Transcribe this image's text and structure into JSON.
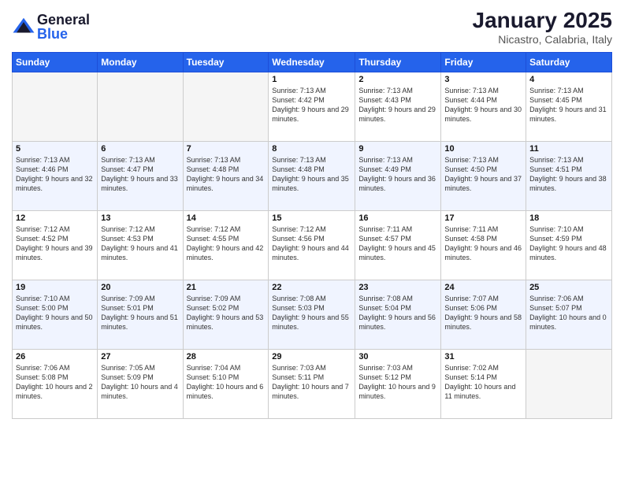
{
  "logo": {
    "general": "General",
    "blue": "Blue"
  },
  "title": "January 2025",
  "location": "Nicastro, Calabria, Italy",
  "days_of_week": [
    "Sunday",
    "Monday",
    "Tuesday",
    "Wednesday",
    "Thursday",
    "Friday",
    "Saturday"
  ],
  "weeks": [
    [
      {
        "num": "",
        "sunrise": "",
        "sunset": "",
        "daylight": ""
      },
      {
        "num": "",
        "sunrise": "",
        "sunset": "",
        "daylight": ""
      },
      {
        "num": "",
        "sunrise": "",
        "sunset": "",
        "daylight": ""
      },
      {
        "num": "1",
        "sunrise": "Sunrise: 7:13 AM",
        "sunset": "Sunset: 4:42 PM",
        "daylight": "Daylight: 9 hours and 29 minutes."
      },
      {
        "num": "2",
        "sunrise": "Sunrise: 7:13 AM",
        "sunset": "Sunset: 4:43 PM",
        "daylight": "Daylight: 9 hours and 29 minutes."
      },
      {
        "num": "3",
        "sunrise": "Sunrise: 7:13 AM",
        "sunset": "Sunset: 4:44 PM",
        "daylight": "Daylight: 9 hours and 30 minutes."
      },
      {
        "num": "4",
        "sunrise": "Sunrise: 7:13 AM",
        "sunset": "Sunset: 4:45 PM",
        "daylight": "Daylight: 9 hours and 31 minutes."
      }
    ],
    [
      {
        "num": "5",
        "sunrise": "Sunrise: 7:13 AM",
        "sunset": "Sunset: 4:46 PM",
        "daylight": "Daylight: 9 hours and 32 minutes."
      },
      {
        "num": "6",
        "sunrise": "Sunrise: 7:13 AM",
        "sunset": "Sunset: 4:47 PM",
        "daylight": "Daylight: 9 hours and 33 minutes."
      },
      {
        "num": "7",
        "sunrise": "Sunrise: 7:13 AM",
        "sunset": "Sunset: 4:48 PM",
        "daylight": "Daylight: 9 hours and 34 minutes."
      },
      {
        "num": "8",
        "sunrise": "Sunrise: 7:13 AM",
        "sunset": "Sunset: 4:48 PM",
        "daylight": "Daylight: 9 hours and 35 minutes."
      },
      {
        "num": "9",
        "sunrise": "Sunrise: 7:13 AM",
        "sunset": "Sunset: 4:49 PM",
        "daylight": "Daylight: 9 hours and 36 minutes."
      },
      {
        "num": "10",
        "sunrise": "Sunrise: 7:13 AM",
        "sunset": "Sunset: 4:50 PM",
        "daylight": "Daylight: 9 hours and 37 minutes."
      },
      {
        "num": "11",
        "sunrise": "Sunrise: 7:13 AM",
        "sunset": "Sunset: 4:51 PM",
        "daylight": "Daylight: 9 hours and 38 minutes."
      }
    ],
    [
      {
        "num": "12",
        "sunrise": "Sunrise: 7:12 AM",
        "sunset": "Sunset: 4:52 PM",
        "daylight": "Daylight: 9 hours and 39 minutes."
      },
      {
        "num": "13",
        "sunrise": "Sunrise: 7:12 AM",
        "sunset": "Sunset: 4:53 PM",
        "daylight": "Daylight: 9 hours and 41 minutes."
      },
      {
        "num": "14",
        "sunrise": "Sunrise: 7:12 AM",
        "sunset": "Sunset: 4:55 PM",
        "daylight": "Daylight: 9 hours and 42 minutes."
      },
      {
        "num": "15",
        "sunrise": "Sunrise: 7:12 AM",
        "sunset": "Sunset: 4:56 PM",
        "daylight": "Daylight: 9 hours and 44 minutes."
      },
      {
        "num": "16",
        "sunrise": "Sunrise: 7:11 AM",
        "sunset": "Sunset: 4:57 PM",
        "daylight": "Daylight: 9 hours and 45 minutes."
      },
      {
        "num": "17",
        "sunrise": "Sunrise: 7:11 AM",
        "sunset": "Sunset: 4:58 PM",
        "daylight": "Daylight: 9 hours and 46 minutes."
      },
      {
        "num": "18",
        "sunrise": "Sunrise: 7:10 AM",
        "sunset": "Sunset: 4:59 PM",
        "daylight": "Daylight: 9 hours and 48 minutes."
      }
    ],
    [
      {
        "num": "19",
        "sunrise": "Sunrise: 7:10 AM",
        "sunset": "Sunset: 5:00 PM",
        "daylight": "Daylight: 9 hours and 50 minutes."
      },
      {
        "num": "20",
        "sunrise": "Sunrise: 7:09 AM",
        "sunset": "Sunset: 5:01 PM",
        "daylight": "Daylight: 9 hours and 51 minutes."
      },
      {
        "num": "21",
        "sunrise": "Sunrise: 7:09 AM",
        "sunset": "Sunset: 5:02 PM",
        "daylight": "Daylight: 9 hours and 53 minutes."
      },
      {
        "num": "22",
        "sunrise": "Sunrise: 7:08 AM",
        "sunset": "Sunset: 5:03 PM",
        "daylight": "Daylight: 9 hours and 55 minutes."
      },
      {
        "num": "23",
        "sunrise": "Sunrise: 7:08 AM",
        "sunset": "Sunset: 5:04 PM",
        "daylight": "Daylight: 9 hours and 56 minutes."
      },
      {
        "num": "24",
        "sunrise": "Sunrise: 7:07 AM",
        "sunset": "Sunset: 5:06 PM",
        "daylight": "Daylight: 9 hours and 58 minutes."
      },
      {
        "num": "25",
        "sunrise": "Sunrise: 7:06 AM",
        "sunset": "Sunset: 5:07 PM",
        "daylight": "Daylight: 10 hours and 0 minutes."
      }
    ],
    [
      {
        "num": "26",
        "sunrise": "Sunrise: 7:06 AM",
        "sunset": "Sunset: 5:08 PM",
        "daylight": "Daylight: 10 hours and 2 minutes."
      },
      {
        "num": "27",
        "sunrise": "Sunrise: 7:05 AM",
        "sunset": "Sunset: 5:09 PM",
        "daylight": "Daylight: 10 hours and 4 minutes."
      },
      {
        "num": "28",
        "sunrise": "Sunrise: 7:04 AM",
        "sunset": "Sunset: 5:10 PM",
        "daylight": "Daylight: 10 hours and 6 minutes."
      },
      {
        "num": "29",
        "sunrise": "Sunrise: 7:03 AM",
        "sunset": "Sunset: 5:11 PM",
        "daylight": "Daylight: 10 hours and 7 minutes."
      },
      {
        "num": "30",
        "sunrise": "Sunrise: 7:03 AM",
        "sunset": "Sunset: 5:12 PM",
        "daylight": "Daylight: 10 hours and 9 minutes."
      },
      {
        "num": "31",
        "sunrise": "Sunrise: 7:02 AM",
        "sunset": "Sunset: 5:14 PM",
        "daylight": "Daylight: 10 hours and 11 minutes."
      },
      {
        "num": "",
        "sunrise": "",
        "sunset": "",
        "daylight": ""
      }
    ]
  ]
}
